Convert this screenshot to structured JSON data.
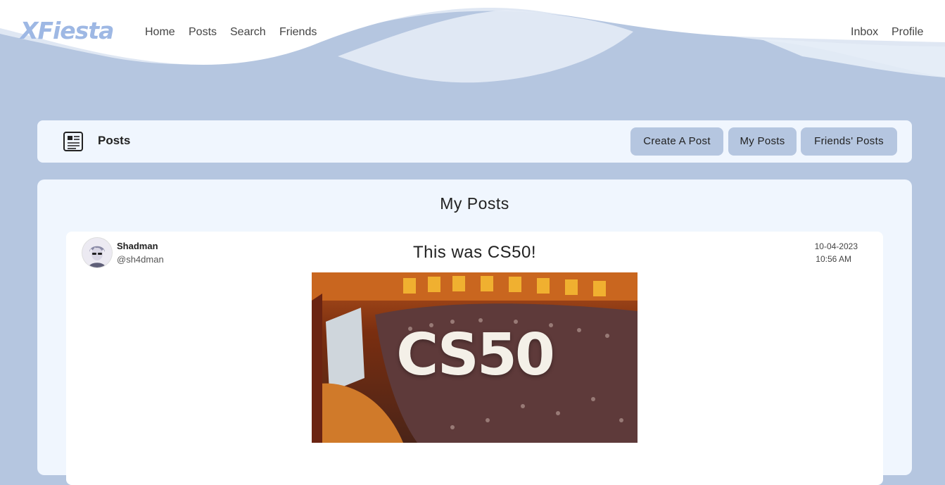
{
  "brand": {
    "logo": "XFiesta"
  },
  "nav": {
    "left": [
      "Home",
      "Posts",
      "Search",
      "Friends"
    ],
    "right": [
      "Inbox",
      "Profile"
    ]
  },
  "posts_panel": {
    "title": "Posts",
    "icon": "newspaper-icon",
    "buttons": [
      "Create A Post",
      "My Posts",
      "Friends' Posts"
    ]
  },
  "main": {
    "title": "My Posts",
    "post": {
      "author_name": "Shadman",
      "author_handle": "@sh4dman",
      "title": "This was CS50!",
      "date": "10-04-2023",
      "time": "10:56 AM",
      "image_text": "CS50"
    }
  },
  "colors": {
    "background": "#b5c6e0",
    "panel": "#f0f6fe",
    "logo": "#9eb8e4",
    "button": "#b5c6e0"
  }
}
